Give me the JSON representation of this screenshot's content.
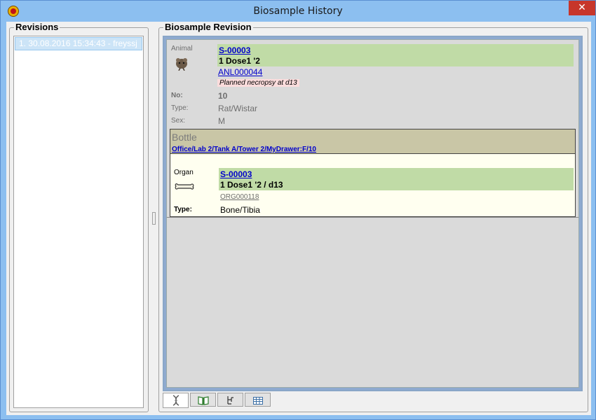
{
  "window": {
    "title": "Biosample History",
    "close": "✕"
  },
  "revisions": {
    "title": "Revisions",
    "items": [
      "1. 30.08.2016 15:34:43 - freyssj"
    ]
  },
  "biosample": {
    "title": "Biosample Revision",
    "animal": {
      "label": "Animal",
      "id": "S-00003",
      "group": "1 Dose1 '2",
      "code": "ANL000044",
      "note": "Planned necropsy at d13",
      "no_label": "No:",
      "no_value": "10",
      "type_label": "Type:",
      "type_value": "Rat/Wistar",
      "sex_label": "Sex:",
      "sex_value": "M"
    },
    "bottle": {
      "title": "Bottle",
      "location": "Office/Lab 2/Tank A/Tower 2/MyDrawer:F/10"
    },
    "organ": {
      "label": "Organ",
      "id": "S-00003",
      "group": "1 Dose1 '2 / d13",
      "code": "ORG000118",
      "type_label": "Type:",
      "type_value": "Bone/Tibia"
    }
  },
  "tabs": [
    {
      "icon": "dna-icon",
      "active": true
    },
    {
      "icon": "book-icon",
      "active": false
    },
    {
      "icon": "tree-icon",
      "active": false
    },
    {
      "icon": "table-icon",
      "active": false
    }
  ]
}
